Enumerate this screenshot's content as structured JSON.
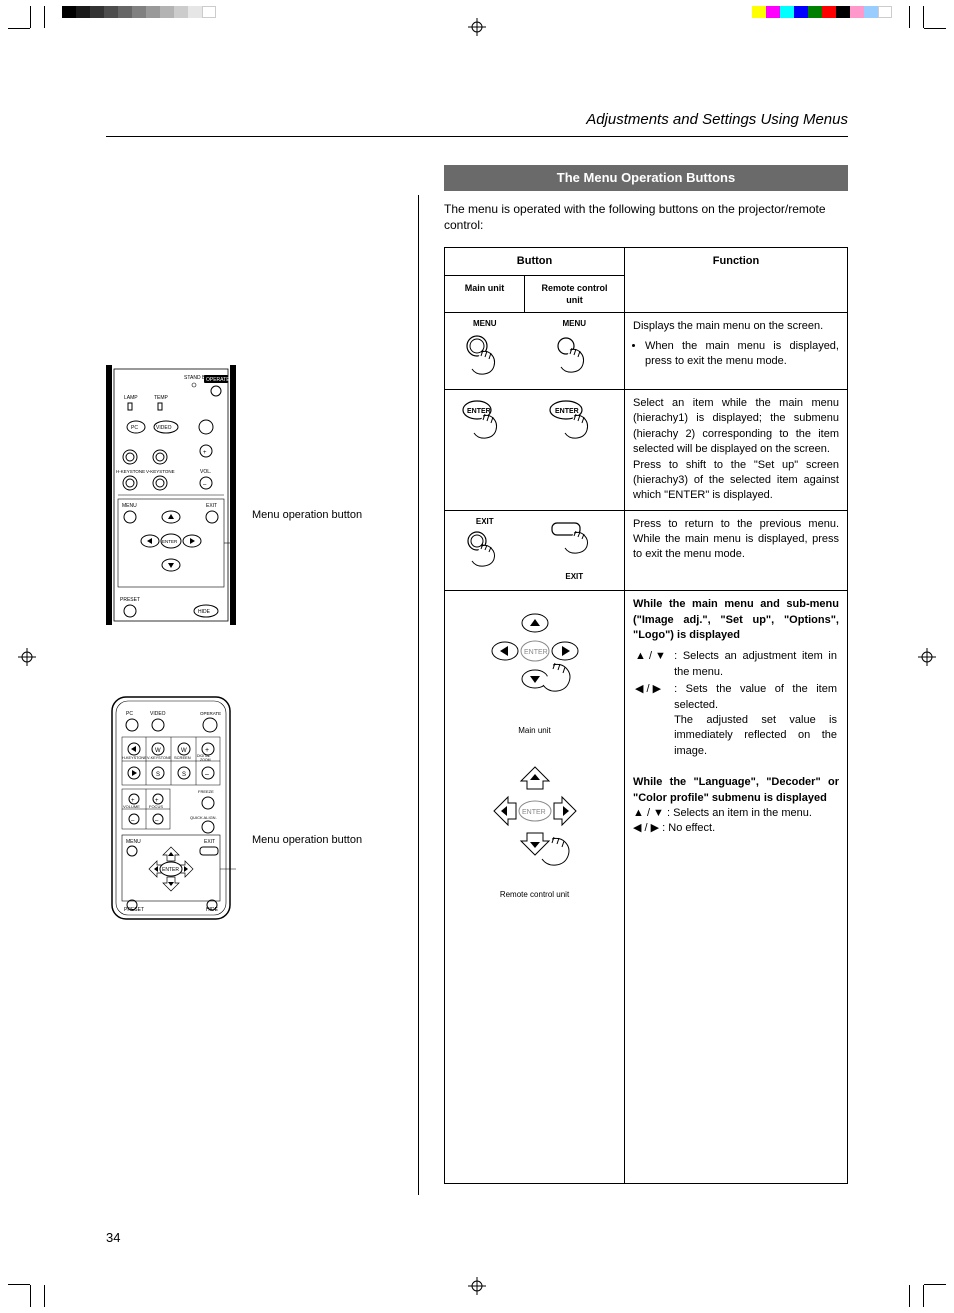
{
  "header": {
    "running_head": "Adjustments and Settings Using Menus"
  },
  "section": {
    "title": "The Menu Operation Buttons",
    "intro": "The menu is operated with the following buttons on the projector/remote control:"
  },
  "table": {
    "head_button": "Button",
    "head_function": "Function",
    "head_main_unit": "Main unit",
    "head_remote": "Remote control unit",
    "rows": [
      {
        "main_label": "MENU",
        "remote_label": "MENU",
        "function_html": "Displays the main menu on the screen.",
        "bullet": "When the main menu is displayed, press to exit the menu mode."
      },
      {
        "main_label": "ENTER",
        "remote_label": "ENTER",
        "function_html": "Select an item while the main menu (hierachy1) is displayed; the submenu (hierachy 2) corresponding to the item selected will be displayed on the screen.",
        "function_html2": "Press to shift to the \"Set up\" screen (hierachy3) of the selected item against which \"ENTER\" is displayed."
      },
      {
        "main_label": "EXIT",
        "remote_label": "EXIT",
        "function_html": "Press to return to the previous menu. While the main menu is displayed, press to exit the menu mode."
      },
      {
        "main_caption": "Main unit",
        "remote_caption": "Remote control unit",
        "f_heading1": "While the main menu and sub-menu (\"Image adj.\", \"Set up\", \"Options\", \"Logo\") is displayed",
        "f_item1a": ": Selects an adjustment item in the menu.",
        "f_item1b": ": Sets the value of the item selected.",
        "f_item1b_2": "The adjusted set value is immediately reflected on the image.",
        "f_heading2": "While the \"Language\", \"Decoder\" or \"Color profile\" submenu is displayed",
        "f_item2a": ": Selects an item in the menu.",
        "f_item2b": ": No effect."
      }
    ]
  },
  "left": {
    "callout1": "Menu operation button",
    "callout2": "Menu operation button",
    "panel_labels": {
      "standby": "STAND BY",
      "operate": "OPERATE",
      "lamp": "LAMP",
      "temp": "TEMP",
      "pc": "PC",
      "video": "VIDEO",
      "hkey": "H-KEYSTONE",
      "vkey": "V-KEYSTONE",
      "vol": "VOL.",
      "menu": "MENU",
      "exit": "EXIT",
      "enter": "ENTER",
      "preset": "PRESET",
      "hide": "HIDE"
    },
    "remote_labels": {
      "pc": "PC",
      "video": "VIDEO",
      "operate": "OPERATE",
      "hkey": "H-KEYSTONE",
      "vkey": "V-KEYSTONE",
      "screen": "SCREEN",
      "dzoom": "DIGITAL ZOOM",
      "volume": "VOLUME",
      "focus": "FOCUS",
      "freeze": "FREEZE",
      "qalign": "QUICK ALIGN.",
      "menu": "MENU",
      "exit": "EXIT",
      "enter": "ENTER",
      "preset": "PRESET",
      "hide": "HIDE"
    }
  },
  "page_number": "34"
}
